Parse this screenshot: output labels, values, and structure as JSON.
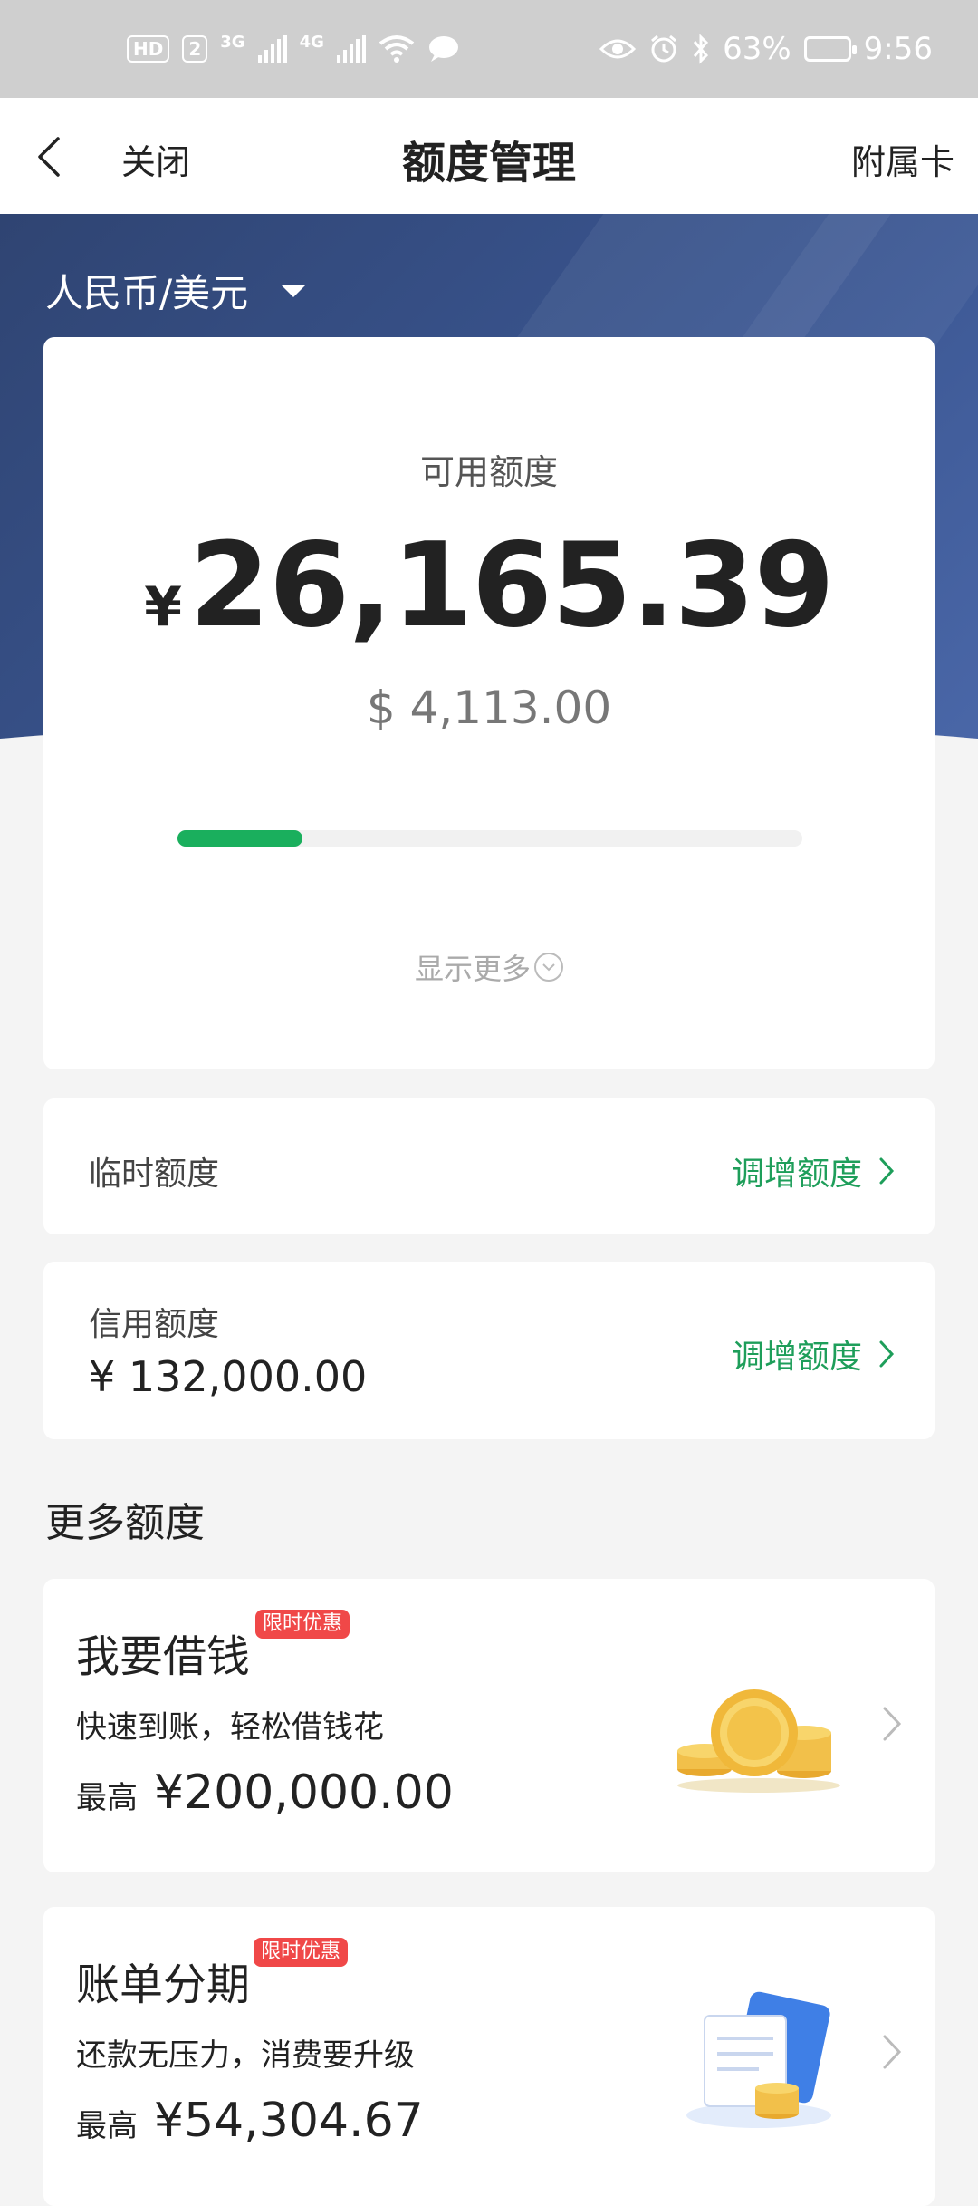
{
  "status_bar": {
    "badge_hd": "HD",
    "badge_sim": "2",
    "net_1": "3G",
    "net_2": "4G",
    "battery_text": "63%",
    "battery_level": 0.63,
    "time": "9:56"
  },
  "nav": {
    "close_label": "关闭",
    "title": "额度管理",
    "right_label": "附属卡"
  },
  "currency_selector": {
    "label": "人民币/美元"
  },
  "available": {
    "label": "可用额度",
    "currency_symbol": "¥",
    "amount": "26,165.39",
    "usd_amount": "$ 4,113.00",
    "usage_fraction": 0.2,
    "show_more_label": "显示更多"
  },
  "temporary_limit": {
    "label": "临时额度",
    "action_label": "调增额度"
  },
  "credit_limit": {
    "label": "信用额度",
    "value": "¥ 132,000.00",
    "action_label": "调增额度"
  },
  "more_limits": {
    "title": "更多额度",
    "items": [
      {
        "title": "我要借钱",
        "tag": "限时优惠",
        "description": "快速到账，轻松借钱花",
        "amount_label": "最高",
        "amount": "¥200,000.00",
        "icon": "gold-coins-icon"
      },
      {
        "title": "账单分期",
        "tag": "限时优惠",
        "description": "还款无压力，消费要升级",
        "amount_label": "最高",
        "amount": "¥54,304.67",
        "icon": "bill-card-coins-icon"
      }
    ]
  },
  "colors": {
    "accent_green": "#1aaf5d",
    "hero_blue": "#34497c",
    "tag_red": "#f04848"
  }
}
